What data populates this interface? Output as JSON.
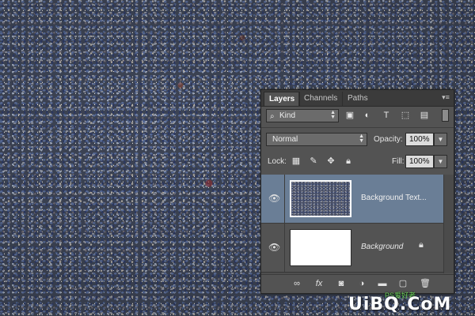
{
  "layers_panel": {
    "tabs": [
      {
        "label": "Layers",
        "active": true
      },
      {
        "label": "Channels",
        "active": false
      },
      {
        "label": "Paths",
        "active": false
      }
    ],
    "filter": {
      "kind_label": "Kind",
      "icons": [
        "image-filter-icon",
        "adjustment-filter-icon",
        "type-filter-icon",
        "shape-filter-icon",
        "smart-object-filter-icon"
      ]
    },
    "blend_mode": "Normal",
    "opacity_label": "Opacity:",
    "opacity_value": "100%",
    "lock_label": "Lock:",
    "fill_label": "Fill:",
    "fill_value": "100%",
    "layers": [
      {
        "name": "Background Text...",
        "visible": true,
        "selected": true,
        "thumbnail": "texture"
      },
      {
        "name": "Background",
        "visible": true,
        "selected": false,
        "locked": true,
        "thumbnail": "white"
      }
    ],
    "bottom_icons": [
      "link-layers-icon",
      "layer-style-fx-icon",
      "layer-mask-icon",
      "adjustment-layer-icon",
      "new-group-folder-icon",
      "new-layer-icon",
      "delete-trash-icon"
    ]
  },
  "watermark": {
    "main": "UiBQ.CoM",
    "small": "PS爱好者"
  },
  "colors": {
    "panel_bg": "#535353",
    "selected_row": "#6a7e96"
  }
}
